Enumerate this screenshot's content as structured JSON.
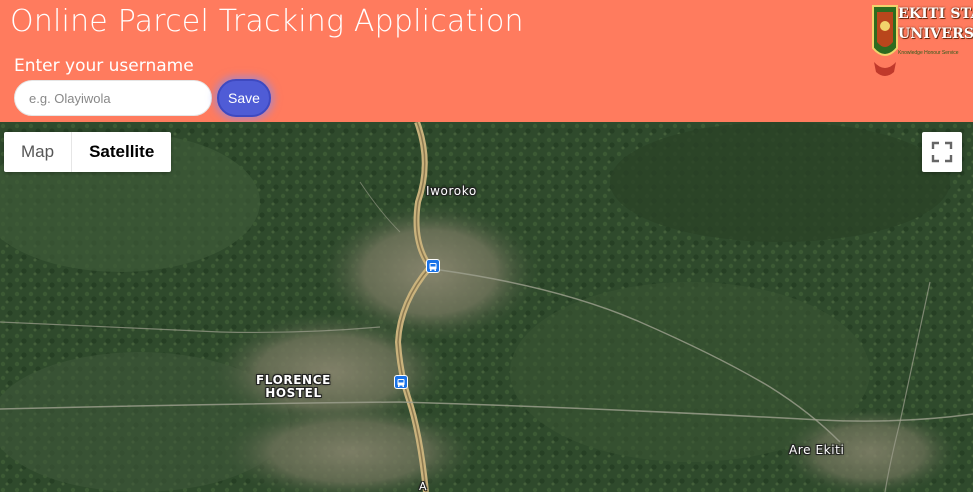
{
  "header": {
    "title": "Online Parcel Tracking Application",
    "username_label": "Enter your username",
    "username_placeholder": "e.g. Olayiwola",
    "username_value": "",
    "save_label": "Save",
    "background_color": "#ff7b5e",
    "save_button_color": "#4f5cd6"
  },
  "logo": {
    "line1": "EKITI STATE",
    "line2": "UNIVERSITY",
    "tagline": "Knowledge Honour Service"
  },
  "map": {
    "type_control": {
      "map_label": "Map",
      "satellite_label": "Satellite",
      "selected": "Satellite"
    },
    "fullscreen_icon": "fullscreen-icon",
    "places": {
      "iworoko": "Iworoko",
      "florence_line1": "FLORENCE",
      "florence_line2": "HOSTEL",
      "are_ekiti": "Are Ekiti",
      "road_partial": "A"
    },
    "transit_icon": "bus-stop-icon"
  }
}
